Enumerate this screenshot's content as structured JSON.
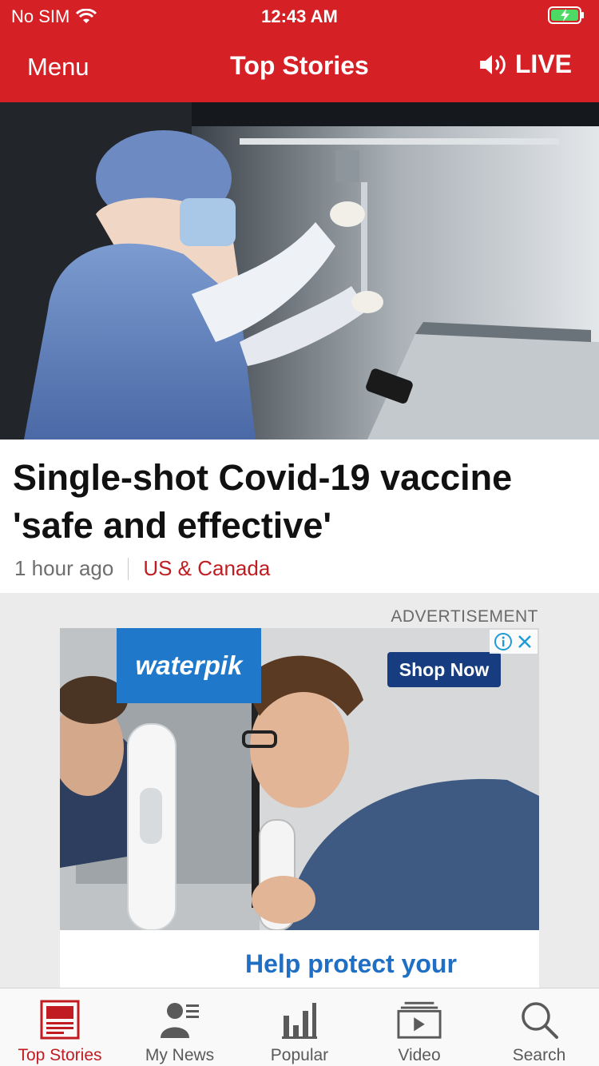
{
  "status_bar": {
    "carrier": "No SIM",
    "time": "12:43 AM"
  },
  "header": {
    "menu_label": "Menu",
    "title": "Top Stories",
    "live_label": "LIVE"
  },
  "story": {
    "headline": "Single-shot Covid-19 vaccine 'safe and effective'",
    "time_ago": "1 hour ago",
    "topic": "US & Canada"
  },
  "ad": {
    "label": "ADVERTISEMENT",
    "brand": "waterpik",
    "cta": "Shop Now",
    "tagline": "Help protect your"
  },
  "tabs": [
    {
      "label": "Top Stories",
      "icon": "top-stories-icon",
      "active": true
    },
    {
      "label": "My News",
      "icon": "my-news-icon",
      "active": false
    },
    {
      "label": "Popular",
      "icon": "popular-icon",
      "active": false
    },
    {
      "label": "Video",
      "icon": "video-icon",
      "active": false
    },
    {
      "label": "Search",
      "icon": "search-icon",
      "active": false
    }
  ],
  "colors": {
    "brand_red": "#d52126",
    "topic_red": "#c01c22",
    "ad_blue": "#1f78c9",
    "ad_navy": "#173c80"
  }
}
